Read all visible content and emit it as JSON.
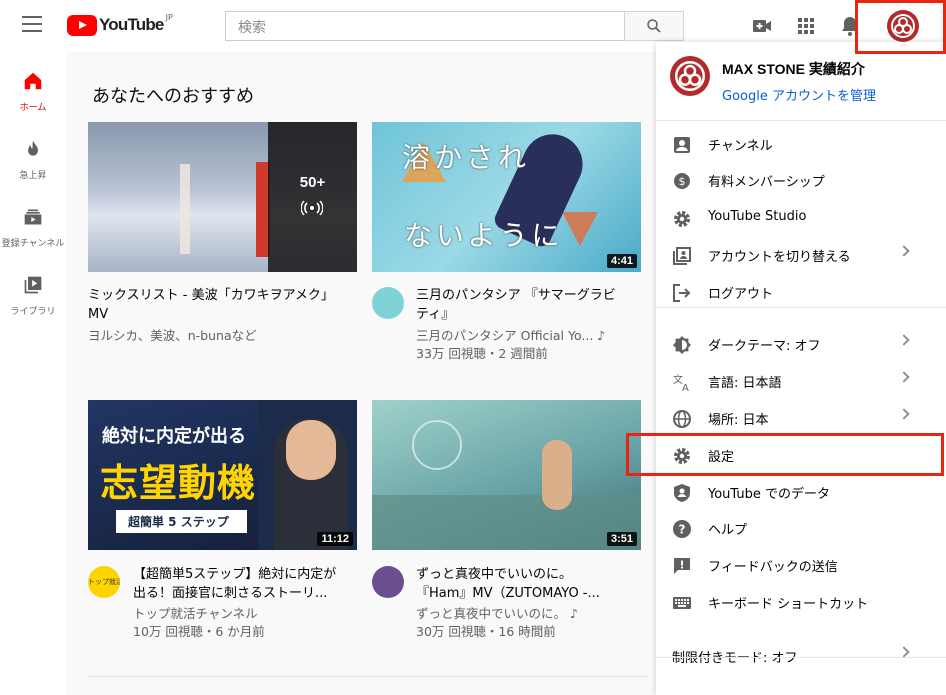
{
  "header": {
    "logo_text": "YouTube",
    "logo_region": "JP",
    "search_placeholder": "検索"
  },
  "sidebar": {
    "items": [
      {
        "label": "ホーム",
        "icon": "home-icon",
        "active": true
      },
      {
        "label": "急上昇",
        "icon": "trending-icon"
      },
      {
        "label": "登録チャンネル",
        "icon": "subscriptions-icon"
      },
      {
        "label": "ライブラリ",
        "icon": "library-icon"
      }
    ]
  },
  "main": {
    "section_title": "あなたへのおすすめ",
    "videos": [
      {
        "title_line1": "ミックスリスト - 美波「カワキヲアメク」",
        "title_line2": "MV",
        "meta1": "ヨルシカ、美波、n-bunaなど",
        "meta2": "",
        "badge_count": "50+",
        "duration": ""
      },
      {
        "title_line1": "三月のパンタシア 『サマーグラビ",
        "title_line2": "ティ』",
        "meta1": "三月のパンタシア Official Yo... ♪",
        "meta2": "33万 回視聴・2 週間前",
        "duration": "4:41",
        "thumb_text1": "溶かされ",
        "thumb_text2": "ないように"
      },
      {
        "title_line1": "【超簡単5ステップ】絶対に内定が",
        "title_line2": "出る！面接官に刺さるストーリ...",
        "meta1": "トップ就活チャンネル",
        "meta2": "10万 回視聴・6 か月前",
        "duration": "11:12",
        "thumb_text1": "絶対に内定が出る",
        "thumb_text2": "志望動機",
        "thumb_text3": "超簡単 5 ステップ",
        "avatar_text": "トップ就活"
      },
      {
        "title_line1": "ずっと真夜中でいいのに。",
        "title_line2": "『Ham』MV（ZUTOMAYO -...",
        "meta1": "ずっと真夜中でいいのに。 ♪",
        "meta2": "30万 回視聴・16 時間前",
        "duration": "3:51"
      }
    ]
  },
  "account_menu": {
    "account_name": "MAX STONE 実績紹介",
    "manage_link": "Google アカウントを管理",
    "items": [
      {
        "label": "チャンネル",
        "icon": "person-icon"
      },
      {
        "label": "有料メンバーシップ",
        "icon": "dollar-icon"
      },
      {
        "label": "YouTube Studio",
        "icon": "gear-icon"
      },
      {
        "label": "アカウントを切り替える",
        "icon": "switch-account-icon",
        "chevron": true
      },
      {
        "label": "ログアウト",
        "icon": "logout-icon"
      },
      {
        "label": "ダークテーマ: オフ",
        "icon": "dark-theme-icon",
        "chevron": true
      },
      {
        "label": "言語: 日本語",
        "icon": "translate-icon",
        "chevron": true
      },
      {
        "label": "場所: 日本",
        "icon": "globe-icon",
        "chevron": true
      },
      {
        "label": "設定",
        "icon": "gear-icon"
      },
      {
        "label": "YouTube でのデータ",
        "icon": "shield-person-icon"
      },
      {
        "label": "ヘルプ",
        "icon": "help-icon"
      },
      {
        "label": "フィードバックの送信",
        "icon": "feedback-icon"
      },
      {
        "label": "キーボード ショートカット",
        "icon": "keyboard-icon"
      },
      {
        "label": "制限付きモード: オフ",
        "icon": "",
        "chevron": true
      }
    ]
  },
  "colors": {
    "brand_red": "#ff0000",
    "highlight_box": "#e8260f",
    "link_blue": "#065fd4",
    "avatar_red": "#b32a2a"
  }
}
